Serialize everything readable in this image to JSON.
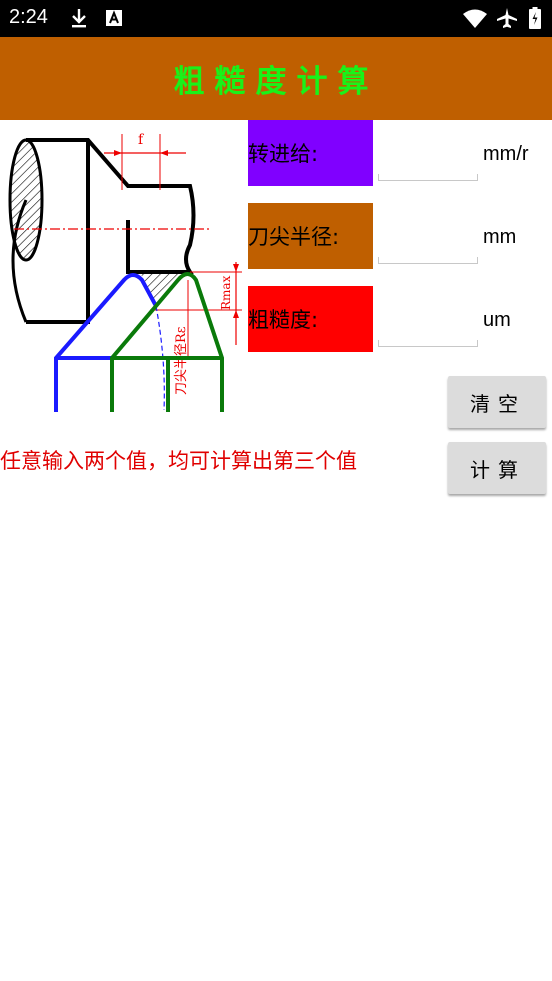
{
  "status_bar": {
    "time": "2:24",
    "left_icons": [
      "download-icon",
      "a-box-icon"
    ],
    "right_icons": [
      "wifi-icon",
      "airplane-icon",
      "battery-icon"
    ]
  },
  "app_bar": {
    "title": "粗糙度计算",
    "background": "#bf5f00",
    "title_color": "#19f219"
  },
  "diagram": {
    "icon": "turning-tool-roughness-diagram",
    "f_label": "f",
    "rmax_label": "Rmax",
    "radius_label": "刀尖半径Rε"
  },
  "fields": [
    {
      "label": "转进给:",
      "unit": "mm/r",
      "value": "",
      "color": "#8000ff"
    },
    {
      "label": "刀尖半径:",
      "unit": "mm",
      "value": "",
      "color": "#bf5f00"
    },
    {
      "label": "粗糙度:",
      "unit": "um",
      "value": "",
      "color": "#ff0000"
    }
  ],
  "buttons": {
    "clear": "清空",
    "calculate": "计算"
  },
  "hint": "任意输入两个值，均可计算出第三个值"
}
